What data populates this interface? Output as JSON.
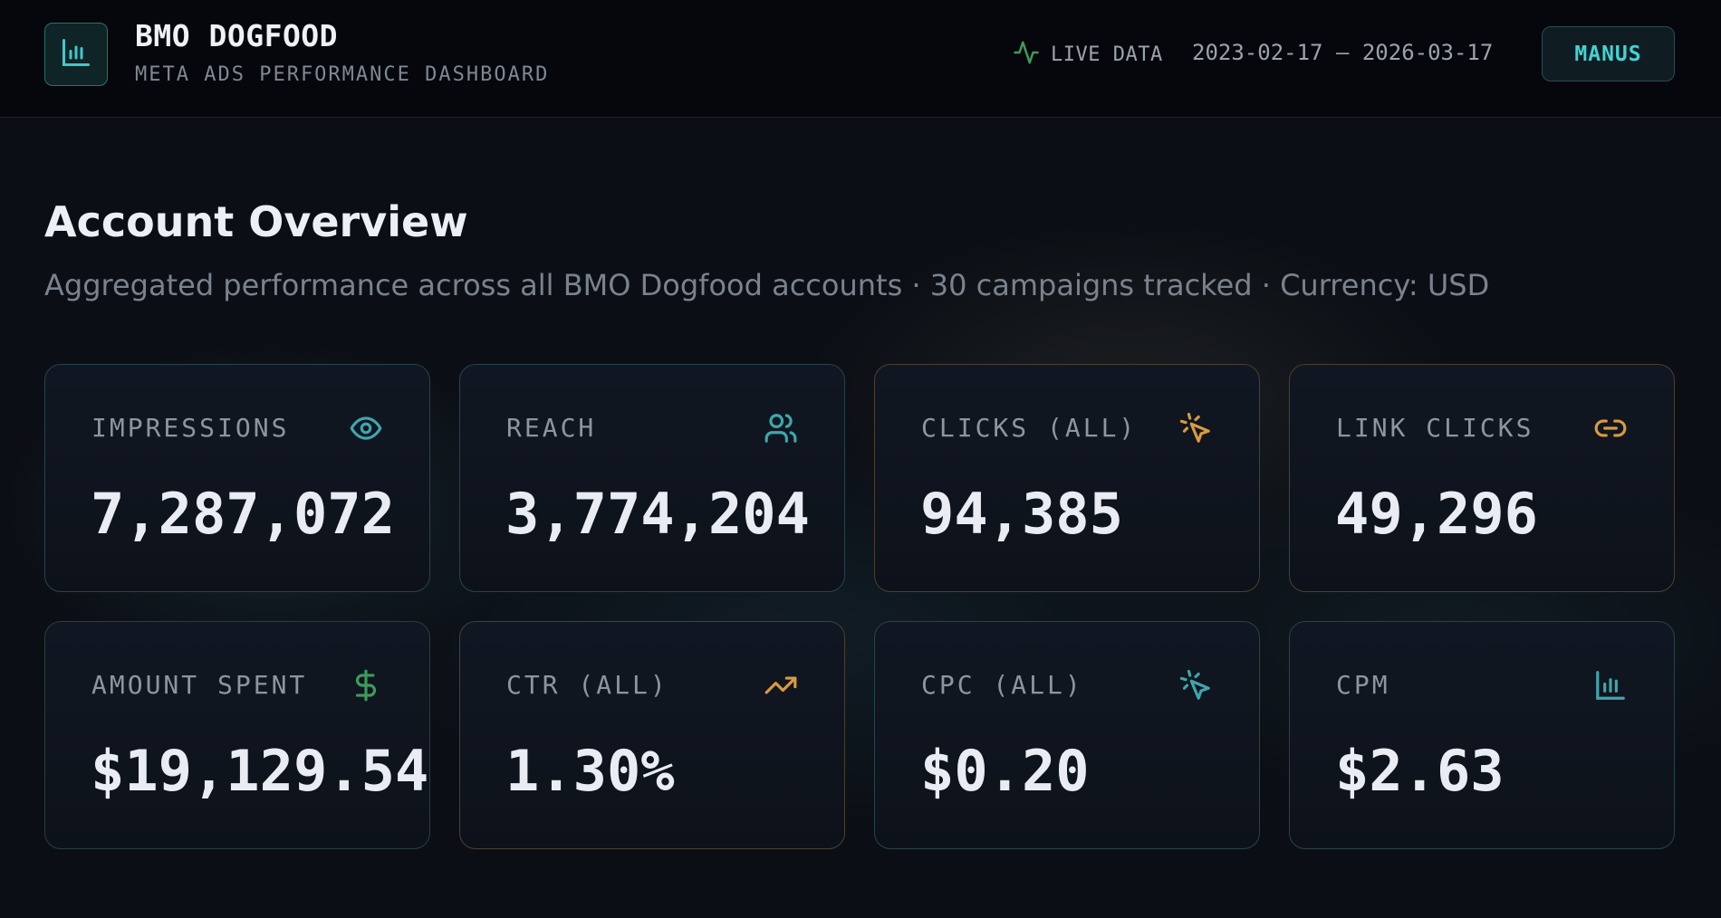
{
  "header": {
    "title": "BMO DOGFOOD",
    "subtitle": "META ADS PERFORMANCE DASHBOARD",
    "live_label": "LIVE DATA",
    "date_range": "2023-02-17 — 2026-03-17",
    "user_button": "MANUS",
    "logo_icon": "bar-chart-icon",
    "live_icon": "activity-icon"
  },
  "overview": {
    "title": "Account Overview",
    "subtitle": "Aggregated performance across all BMO Dogfood accounts · 30 campaigns tracked · Currency: USD"
  },
  "metrics": [
    {
      "label": "IMPRESSIONS",
      "value": "7,287,072",
      "icon": "eye-icon",
      "color": "#3fa6ad"
    },
    {
      "label": "REACH",
      "value": "3,774,204",
      "icon": "users-icon",
      "color": "#3fa6ad"
    },
    {
      "label": "CLICKS (ALL)",
      "value": "94,385",
      "icon": "pointer-click-icon",
      "color": "#d99a3e"
    },
    {
      "label": "LINK CLICKS",
      "value": "49,296",
      "icon": "link-icon",
      "color": "#d99a3e"
    },
    {
      "label": "AMOUNT SPENT",
      "value": "$19,129.54",
      "icon": "dollar-icon",
      "color": "#3f9a5c"
    },
    {
      "label": "CTR (ALL)",
      "value": "1.30%",
      "icon": "trending-up-icon",
      "color": "#d99a3e"
    },
    {
      "label": "CPC (ALL)",
      "value": "$0.20",
      "icon": "pointer-click-icon",
      "color": "#3fa6ad"
    },
    {
      "label": "CPM",
      "value": "$2.63",
      "icon": "bar-chart-icon",
      "color": "#3fa6ad"
    }
  ],
  "colors": {
    "accent": "#45d2d3",
    "live": "#3f9a5c"
  }
}
